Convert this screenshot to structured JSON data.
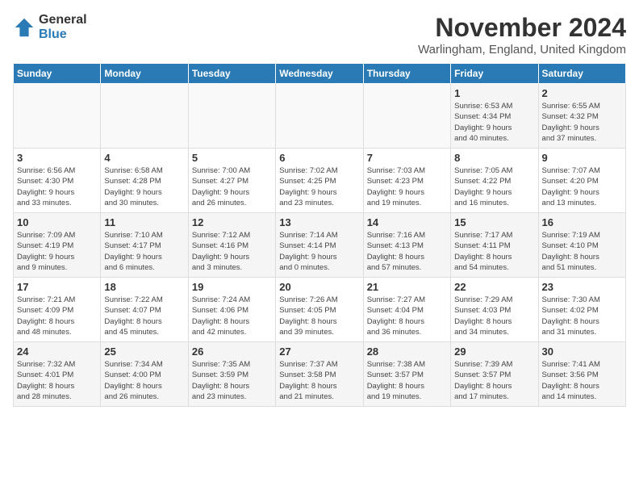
{
  "logo": {
    "general": "General",
    "blue": "Blue"
  },
  "title": "November 2024",
  "location": "Warlingham, England, United Kingdom",
  "weekdays": [
    "Sunday",
    "Monday",
    "Tuesday",
    "Wednesday",
    "Thursday",
    "Friday",
    "Saturday"
  ],
  "weeks": [
    [
      {
        "day": "",
        "info": ""
      },
      {
        "day": "",
        "info": ""
      },
      {
        "day": "",
        "info": ""
      },
      {
        "day": "",
        "info": ""
      },
      {
        "day": "",
        "info": ""
      },
      {
        "day": "1",
        "info": "Sunrise: 6:53 AM\nSunset: 4:34 PM\nDaylight: 9 hours\nand 40 minutes."
      },
      {
        "day": "2",
        "info": "Sunrise: 6:55 AM\nSunset: 4:32 PM\nDaylight: 9 hours\nand 37 minutes."
      }
    ],
    [
      {
        "day": "3",
        "info": "Sunrise: 6:56 AM\nSunset: 4:30 PM\nDaylight: 9 hours\nand 33 minutes."
      },
      {
        "day": "4",
        "info": "Sunrise: 6:58 AM\nSunset: 4:28 PM\nDaylight: 9 hours\nand 30 minutes."
      },
      {
        "day": "5",
        "info": "Sunrise: 7:00 AM\nSunset: 4:27 PM\nDaylight: 9 hours\nand 26 minutes."
      },
      {
        "day": "6",
        "info": "Sunrise: 7:02 AM\nSunset: 4:25 PM\nDaylight: 9 hours\nand 23 minutes."
      },
      {
        "day": "7",
        "info": "Sunrise: 7:03 AM\nSunset: 4:23 PM\nDaylight: 9 hours\nand 19 minutes."
      },
      {
        "day": "8",
        "info": "Sunrise: 7:05 AM\nSunset: 4:22 PM\nDaylight: 9 hours\nand 16 minutes."
      },
      {
        "day": "9",
        "info": "Sunrise: 7:07 AM\nSunset: 4:20 PM\nDaylight: 9 hours\nand 13 minutes."
      }
    ],
    [
      {
        "day": "10",
        "info": "Sunrise: 7:09 AM\nSunset: 4:19 PM\nDaylight: 9 hours\nand 9 minutes."
      },
      {
        "day": "11",
        "info": "Sunrise: 7:10 AM\nSunset: 4:17 PM\nDaylight: 9 hours\nand 6 minutes."
      },
      {
        "day": "12",
        "info": "Sunrise: 7:12 AM\nSunset: 4:16 PM\nDaylight: 9 hours\nand 3 minutes."
      },
      {
        "day": "13",
        "info": "Sunrise: 7:14 AM\nSunset: 4:14 PM\nDaylight: 9 hours\nand 0 minutes."
      },
      {
        "day": "14",
        "info": "Sunrise: 7:16 AM\nSunset: 4:13 PM\nDaylight: 8 hours\nand 57 minutes."
      },
      {
        "day": "15",
        "info": "Sunrise: 7:17 AM\nSunset: 4:11 PM\nDaylight: 8 hours\nand 54 minutes."
      },
      {
        "day": "16",
        "info": "Sunrise: 7:19 AM\nSunset: 4:10 PM\nDaylight: 8 hours\nand 51 minutes."
      }
    ],
    [
      {
        "day": "17",
        "info": "Sunrise: 7:21 AM\nSunset: 4:09 PM\nDaylight: 8 hours\nand 48 minutes."
      },
      {
        "day": "18",
        "info": "Sunrise: 7:22 AM\nSunset: 4:07 PM\nDaylight: 8 hours\nand 45 minutes."
      },
      {
        "day": "19",
        "info": "Sunrise: 7:24 AM\nSunset: 4:06 PM\nDaylight: 8 hours\nand 42 minutes."
      },
      {
        "day": "20",
        "info": "Sunrise: 7:26 AM\nSunset: 4:05 PM\nDaylight: 8 hours\nand 39 minutes."
      },
      {
        "day": "21",
        "info": "Sunrise: 7:27 AM\nSunset: 4:04 PM\nDaylight: 8 hours\nand 36 minutes."
      },
      {
        "day": "22",
        "info": "Sunrise: 7:29 AM\nSunset: 4:03 PM\nDaylight: 8 hours\nand 34 minutes."
      },
      {
        "day": "23",
        "info": "Sunrise: 7:30 AM\nSunset: 4:02 PM\nDaylight: 8 hours\nand 31 minutes."
      }
    ],
    [
      {
        "day": "24",
        "info": "Sunrise: 7:32 AM\nSunset: 4:01 PM\nDaylight: 8 hours\nand 28 minutes."
      },
      {
        "day": "25",
        "info": "Sunrise: 7:34 AM\nSunset: 4:00 PM\nDaylight: 8 hours\nand 26 minutes."
      },
      {
        "day": "26",
        "info": "Sunrise: 7:35 AM\nSunset: 3:59 PM\nDaylight: 8 hours\nand 23 minutes."
      },
      {
        "day": "27",
        "info": "Sunrise: 7:37 AM\nSunset: 3:58 PM\nDaylight: 8 hours\nand 21 minutes."
      },
      {
        "day": "28",
        "info": "Sunrise: 7:38 AM\nSunset: 3:57 PM\nDaylight: 8 hours\nand 19 minutes."
      },
      {
        "day": "29",
        "info": "Sunrise: 7:39 AM\nSunset: 3:57 PM\nDaylight: 8 hours\nand 17 minutes."
      },
      {
        "day": "30",
        "info": "Sunrise: 7:41 AM\nSunset: 3:56 PM\nDaylight: 8 hours\nand 14 minutes."
      }
    ]
  ]
}
